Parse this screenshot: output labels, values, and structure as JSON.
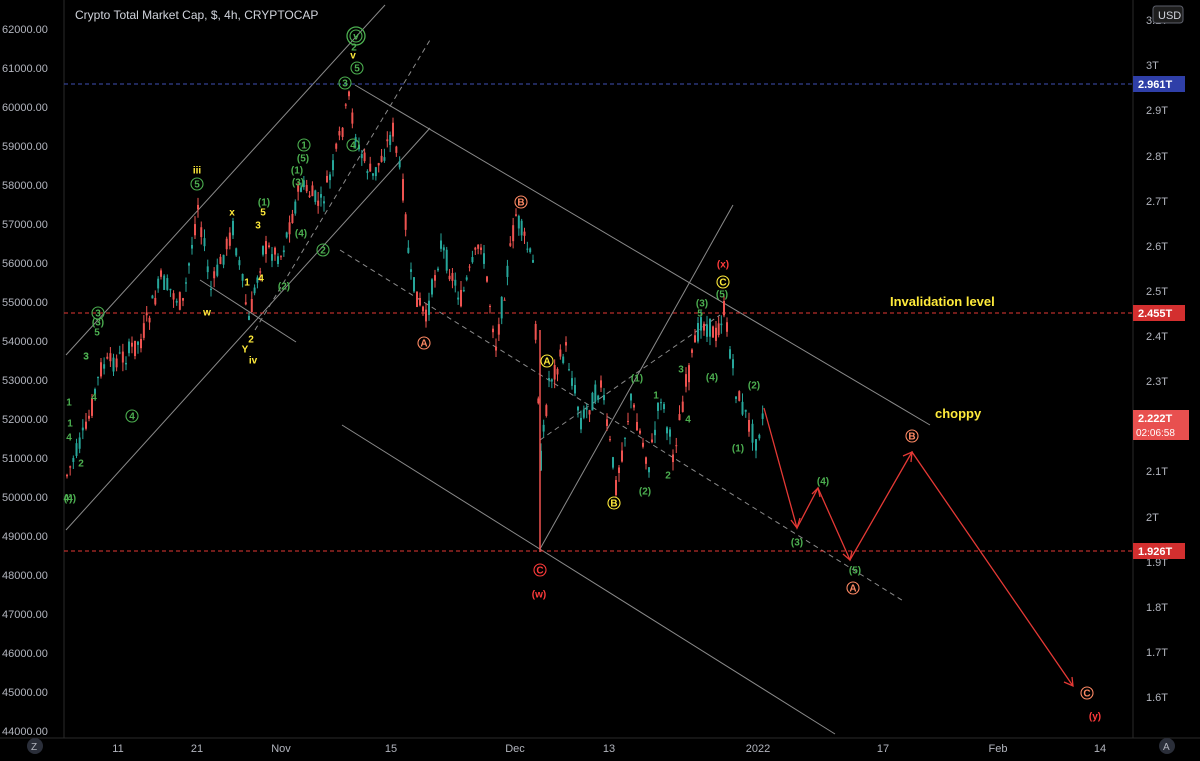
{
  "chart": {
    "title": "Crypto Total Market Cap, $, 4h, CRYPTOCAP",
    "currency_button": "USD",
    "left_corner_button": "Z",
    "right_corner_button": "A",
    "invalidation_text": "Invalidation level",
    "choppy_text": "choppy",
    "countdown": "02:06:58",
    "colors": {
      "bg": "#000000",
      "up": "#26a69a",
      "down": "#ef5350",
      "grid_line": "#4a4a4a",
      "red_dash": "#e53935",
      "blue_dash": "#3f51b5",
      "green_label": "#4caf50",
      "yellow_label": "#ffeb3b",
      "orange_label": "#ff8a65",
      "red_label": "#ff3b3b"
    }
  },
  "chart_data": {
    "type": "candlestick",
    "left_axis": {
      "ticks": [
        "62000.00",
        "61000.00",
        "60000.00",
        "59000.00",
        "58000.00",
        "57000.00",
        "56000.00",
        "55000.00",
        "54000.00",
        "53000.00",
        "52000.00",
        "51000.00",
        "50000.00",
        "49000.00",
        "48000.00",
        "47000.00",
        "46000.00",
        "45000.00",
        "44000.00"
      ]
    },
    "right_axis": {
      "ticks": [
        "3T",
        "2.9T",
        "2.8T",
        "2.7T",
        "2.6T",
        "2.5T",
        "2.4T",
        "2.3T",
        "2T",
        "1.8T",
        "1.7T",
        "1.6T"
      ],
      "partial_ticks": [
        "3.1T",
        "2.2T",
        "2.1T",
        "1.9T"
      ],
      "price_labels": [
        {
          "text": "2.961T",
          "kind": "blue"
        },
        {
          "text": "2.455T",
          "kind": "red"
        },
        {
          "text": "2.222T",
          "kind": "last"
        },
        {
          "text": "1.926T",
          "kind": "red"
        }
      ]
    },
    "x_axis": {
      "ticks": [
        "11",
        "21",
        "Nov",
        "15",
        "Dec",
        "13",
        "2022",
        "17",
        "Feb",
        "14"
      ]
    },
    "horizontal_levels": [
      {
        "value": "2.961T",
        "style": "blue-dashed"
      },
      {
        "value": "2.455T",
        "style": "red-dashed",
        "label": "Invalidation level"
      },
      {
        "value": "1.926T",
        "style": "red-dashed"
      }
    ],
    "wave_labels": [
      {
        "t": "iii",
        "c": "yellow",
        "r": false
      },
      {
        "t": "5",
        "c": "green",
        "r": true
      },
      {
        "t": "x",
        "c": "yellow",
        "r": false
      },
      {
        "t": "5",
        "c": "yellow",
        "r": false
      },
      {
        "t": "3",
        "c": "yellow",
        "r": false
      },
      {
        "t": "w",
        "c": "yellow",
        "r": false
      },
      {
        "t": "1",
        "c": "yellow",
        "r": false
      },
      {
        "t": "4",
        "c": "yellow",
        "r": false
      },
      {
        "t": "2",
        "c": "yellow",
        "r": false
      },
      {
        "t": "Y",
        "c": "yellow",
        "r": false
      },
      {
        "t": "iv",
        "c": "yellow",
        "r": false
      },
      {
        "t": "3",
        "c": "green",
        "r": true
      },
      {
        "t": "(3)",
        "c": "green",
        "r": false
      },
      {
        "t": "5",
        "c": "green",
        "r": false
      },
      {
        "t": "3",
        "c": "green",
        "r": false
      },
      {
        "t": "4",
        "c": "green",
        "r": false
      },
      {
        "t": "4",
        "c": "green",
        "r": true
      },
      {
        "t": "1",
        "c": "green",
        "r": false
      },
      {
        "t": "2",
        "c": "green",
        "r": false
      },
      {
        "t": "(4)",
        "c": "green",
        "r": false
      },
      {
        "t": "(1)",
        "c": "green",
        "r": false
      },
      {
        "t": "(2)",
        "c": "green",
        "r": false
      },
      {
        "t": "(1)",
        "c": "green",
        "r": false
      },
      {
        "t": "(5)",
        "c": "green",
        "r": false
      },
      {
        "t": "1",
        "c": "green",
        "r": true
      },
      {
        "t": "(3)",
        "c": "green",
        "r": false
      },
      {
        "t": "(4)",
        "c": "green",
        "r": false
      },
      {
        "t": "2",
        "c": "green",
        "r": true
      },
      {
        "t": "v",
        "c": "green",
        "r": true
      },
      {
        "t": "v",
        "c": "yellow",
        "r": false
      },
      {
        "t": "5",
        "c": "green",
        "r": true
      },
      {
        "t": "3",
        "c": "green",
        "r": true
      },
      {
        "t": "4",
        "c": "green",
        "r": true
      },
      {
        "t": "B",
        "c": "orange",
        "r": true
      },
      {
        "t": "A",
        "c": "orange",
        "r": true
      },
      {
        "t": "A",
        "c": "yellow",
        "r": true
      },
      {
        "t": "C",
        "c": "red",
        "r": true
      },
      {
        "t": "(w)",
        "c": "red",
        "r": false
      },
      {
        "t": "B",
        "c": "yellow",
        "r": true
      },
      {
        "t": "(2)",
        "c": "green",
        "r": false
      },
      {
        "t": "(1)",
        "c": "green",
        "r": false
      },
      {
        "t": "1",
        "c": "green",
        "r": false
      },
      {
        "t": "2",
        "c": "green",
        "r": false
      },
      {
        "t": "3",
        "c": "green",
        "r": false
      },
      {
        "t": "4",
        "c": "green",
        "r": false
      },
      {
        "t": "(3)",
        "c": "green",
        "r": false
      },
      {
        "t": "5",
        "c": "green",
        "r": false
      },
      {
        "t": "(5)",
        "c": "green",
        "r": false
      },
      {
        "t": "(4)",
        "c": "green",
        "r": false
      },
      {
        "t": "(x)",
        "c": "red",
        "r": false
      },
      {
        "t": "C",
        "c": "yellow",
        "r": true
      },
      {
        "t": "(2)",
        "c": "green",
        "r": false
      },
      {
        "t": "(1)",
        "c": "green",
        "r": false
      },
      {
        "t": "(3)",
        "c": "green",
        "r": false
      },
      {
        "t": "(4)",
        "c": "green",
        "r": false
      },
      {
        "t": "(5)",
        "c": "green",
        "r": false
      },
      {
        "t": "A",
        "c": "orange",
        "r": true
      },
      {
        "t": "B",
        "c": "orange",
        "r": true
      },
      {
        "t": "C",
        "c": "orange",
        "r": true
      },
      {
        "t": "(y)",
        "c": "red",
        "r": false
      },
      {
        "t": "2",
        "c": "green",
        "r": false
      },
      {
        "t": "1",
        "c": "green",
        "r": false
      },
      {
        "t": "4",
        "c": "green",
        "r": false
      },
      {
        "t": "3",
        "c": "green",
        "r": false
      },
      {
        "t": "4)",
        "c": "green",
        "r": false
      }
    ],
    "projection_path": [
      2.222,
      1.99,
      2.08,
      1.93,
      2.14,
      1.62
    ]
  }
}
